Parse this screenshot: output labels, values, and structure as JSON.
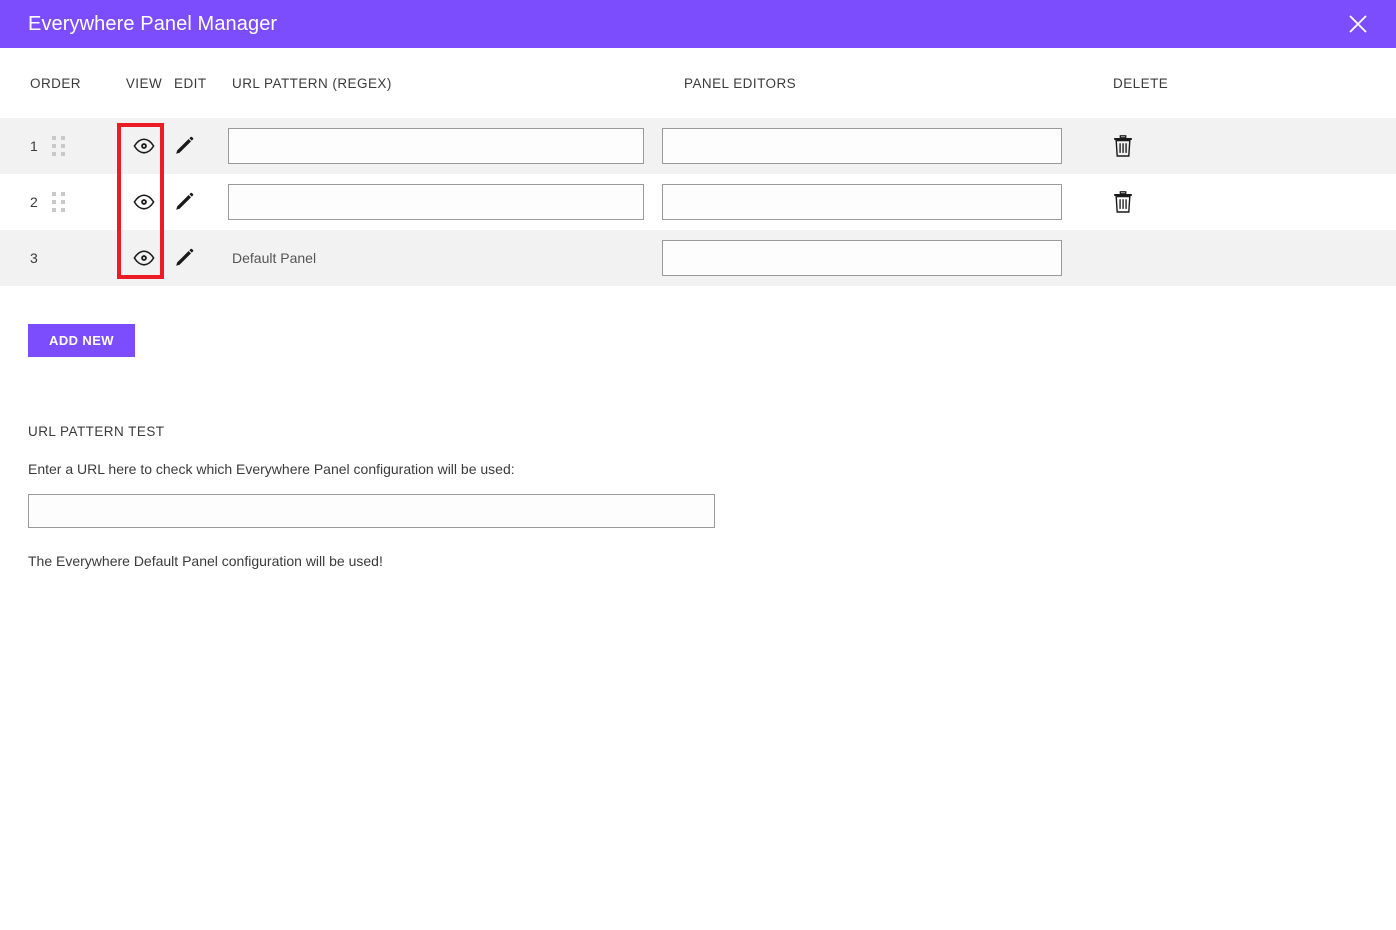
{
  "window": {
    "title": "Everywhere Panel Manager",
    "close_icon": "close-icon"
  },
  "table": {
    "headers": {
      "order": "ORDER",
      "view": "VIEW",
      "edit": "EDIT",
      "url_pattern": "URL PATTERN (REGEX)",
      "panel_editors": "PANEL EDITORS",
      "delete": "DELETE"
    },
    "rows": [
      {
        "order": "1",
        "has_drag_handle": true,
        "view_icon": "eye-icon",
        "edit_icon": "pencil-icon",
        "url_pattern_value": "",
        "url_pattern_placeholder": "",
        "url_pattern_is_input": true,
        "panel_editors_value": "",
        "panel_editors_placeholder": "",
        "has_delete": true,
        "delete_icon": "trash-icon"
      },
      {
        "order": "2",
        "has_drag_handle": true,
        "view_icon": "eye-icon",
        "edit_icon": "pencil-icon",
        "url_pattern_value": "",
        "url_pattern_placeholder": "",
        "url_pattern_is_input": true,
        "panel_editors_value": "",
        "panel_editors_placeholder": "",
        "has_delete": true,
        "delete_icon": "trash-icon"
      },
      {
        "order": "3",
        "has_drag_handle": false,
        "view_icon": "eye-icon",
        "edit_icon": "pencil-icon",
        "url_pattern_value": "Default Panel",
        "url_pattern_placeholder": "",
        "url_pattern_is_input": false,
        "panel_editors_value": "",
        "panel_editors_placeholder": "",
        "has_delete": false,
        "delete_icon": ""
      }
    ]
  },
  "actions": {
    "add_new_label": "ADD NEW"
  },
  "url_pattern_test": {
    "title": "URL PATTERN TEST",
    "description": "Enter a URL here to check which Everywhere Panel configuration will be used:",
    "input_value": "",
    "input_placeholder": "",
    "result": "The Everywhere Default Panel configuration will be used!"
  },
  "annotation": {
    "target": "view-column-eye-icons",
    "color": "#ed1c24"
  },
  "colors": {
    "accent": "#7c4dfd",
    "row_alt": "#f2f2f2",
    "text": "#3b3b3b",
    "annotation": "#ed1c24"
  }
}
